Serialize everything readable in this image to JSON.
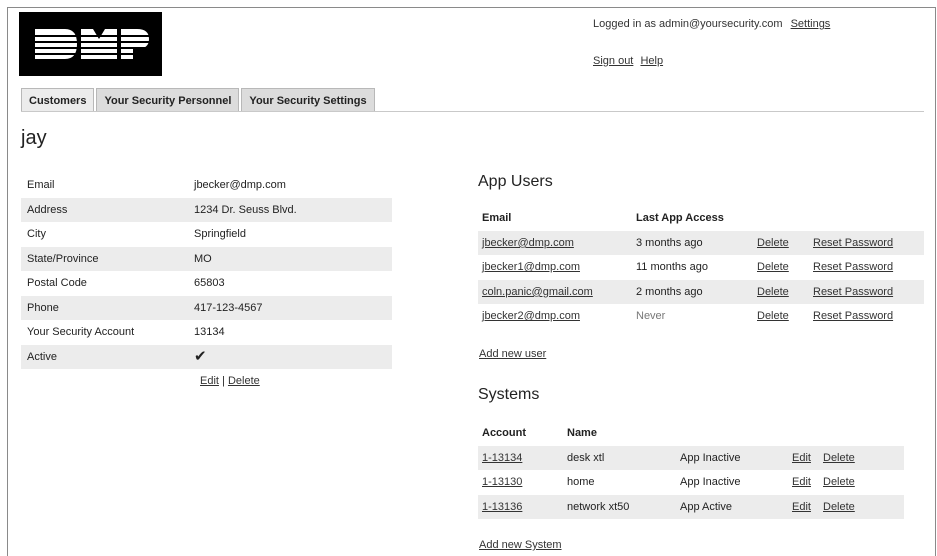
{
  "header": {
    "logo_text": "DMP",
    "logged_in_text": "Logged in as admin@yoursecurity.com",
    "settings_link": "Settings",
    "sign_out_link": "Sign out",
    "help_link": "Help"
  },
  "tabs": [
    {
      "label": "Customers",
      "active": true
    },
    {
      "label": "Your Security Personnel",
      "active": false
    },
    {
      "label": "Your Security Settings",
      "active": false
    }
  ],
  "customer": {
    "name": "jay",
    "fields": [
      {
        "label": "Email",
        "value": "jbecker@dmp.com"
      },
      {
        "label": "Address",
        "value": "1234 Dr. Seuss Blvd."
      },
      {
        "label": "City",
        "value": "Springfield"
      },
      {
        "label": "State/Province",
        "value": "MO"
      },
      {
        "label": "Postal Code",
        "value": "65803"
      },
      {
        "label": "Phone",
        "value": "417-123-4567"
      },
      {
        "label": "Your Security Account",
        "value": "13134"
      },
      {
        "label": "Active",
        "value": "✔",
        "icon": "checkmark-icon"
      }
    ],
    "edit_link": "Edit",
    "separator": "|",
    "delete_link": "Delete"
  },
  "app_users": {
    "title": "App Users",
    "columns": [
      "Email",
      "Last App Access"
    ],
    "rows": [
      {
        "email": "jbecker@dmp.com",
        "last_access": "3 months ago",
        "delete": "Delete",
        "reset": "Reset Password"
      },
      {
        "email": "jbecker1@dmp.com",
        "last_access": "11 months ago",
        "delete": "Delete",
        "reset": "Reset Password"
      },
      {
        "email": "coln.panic@gmail.com",
        "last_access": "2 months ago",
        "delete": "Delete",
        "reset": "Reset Password"
      },
      {
        "email": "jbecker2@dmp.com",
        "last_access": "Never",
        "delete": "Delete",
        "reset": "Reset Password"
      }
    ],
    "add_link": "Add new user"
  },
  "systems": {
    "title": "Systems",
    "columns": [
      "Account",
      "Name"
    ],
    "rows": [
      {
        "account": "1-13134",
        "name": "desk xtl",
        "status": "App Inactive",
        "edit": "Edit",
        "delete": "Delete"
      },
      {
        "account": "1-13130",
        "name": "home",
        "status": "App Inactive",
        "edit": "Edit",
        "delete": "Delete"
      },
      {
        "account": "1-13136",
        "name": "network xt50",
        "status": "App Active",
        "edit": "Edit",
        "delete": "Delete"
      }
    ],
    "add_link": "Add new System"
  }
}
